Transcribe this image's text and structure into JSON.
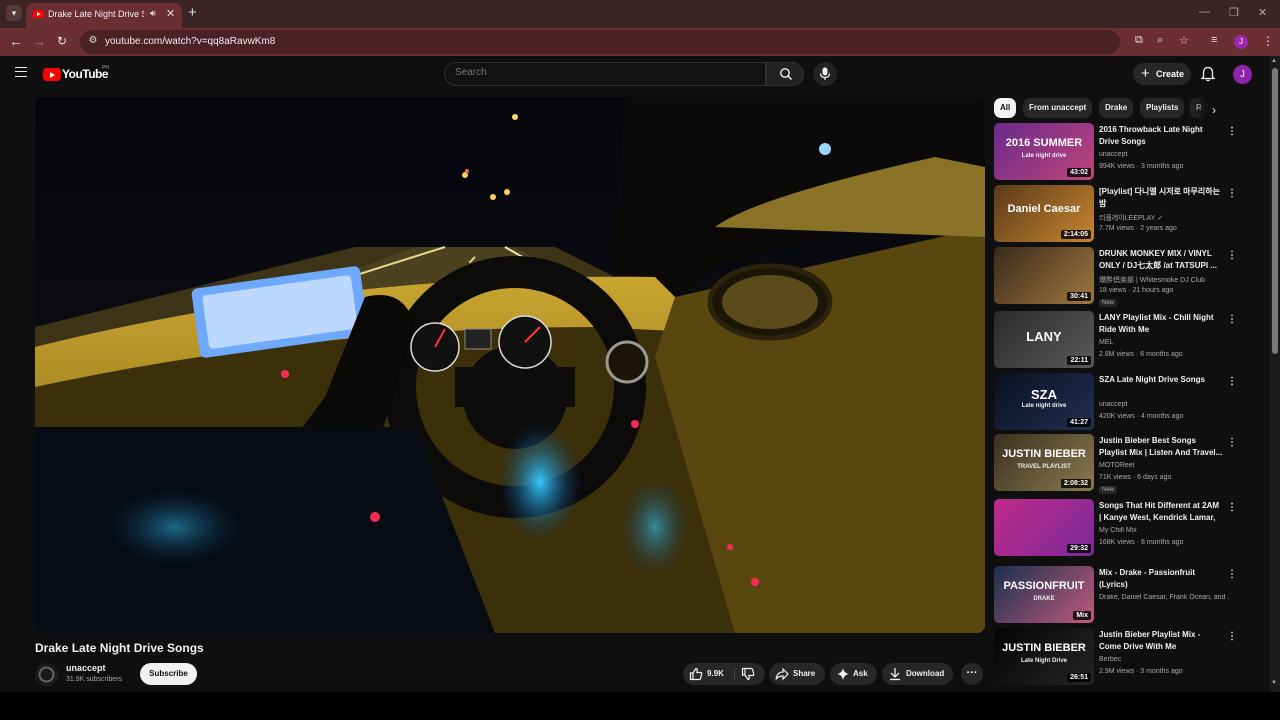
{
  "browser": {
    "tab_title": "Drake Late Night Drive Songs",
    "url": "youtube.com/watch?v=qq8aRavwKm8",
    "profile_initial": "J"
  },
  "header": {
    "logo_text": "YouTube",
    "country_code": "PH",
    "search_placeholder": "Search",
    "create_label": "Create",
    "avatar_initial": "J"
  },
  "video": {
    "title": "Drake Late Night Drive Songs",
    "channel": "unaccept",
    "subscribers": "31.9K subscribers",
    "subscribe_label": "Subscribe",
    "likes": "9.9K",
    "share_label": "Share",
    "ask_label": "Ask",
    "download_label": "Download"
  },
  "chips": [
    "All",
    "From unaccept",
    "Drake",
    "Playlists",
    "R"
  ],
  "recommendations": [
    {
      "title": "2016 Throwback Late Night Drive Songs",
      "channel": "unaccept",
      "meta": "994K views · 3 months ago",
      "duration": "43:02",
      "badge": "",
      "thumb_text": "2016 SUMMER",
      "thumb_sub": "Late night drive",
      "thumb_colors": [
        "#6a2a8c",
        "#c0457a"
      ]
    },
    {
      "title": "[Playlist] 다니엘 시저로 마무리하는 밤",
      "channel": "리플레이LEEPLAY ✓",
      "meta": "7.7M views · 2 years ago",
      "duration": "2:14:05",
      "badge": "",
      "thumb_text": "Daniel Caesar",
      "thumb_sub": "",
      "thumb_colors": [
        "#5a3a1a",
        "#c8862e"
      ]
    },
    {
      "title": "DRUNK MONKEY MIX / VINYL ONLY / DJ七太郎 /at TATSUPI ...",
      "channel": "爆酔倶楽部 | Whitesmoke DJ Club",
      "meta": "18 views · 21 hours ago",
      "duration": "30:41",
      "badge": "New",
      "thumb_text": "",
      "thumb_sub": "",
      "thumb_colors": [
        "#3a2a1a",
        "#a07840"
      ]
    },
    {
      "title": "LANY Playlist Mix - Chill Night Ride With Me",
      "channel": "MEL",
      "meta": "2.8M views · 6 months ago",
      "duration": "22:11",
      "badge": "",
      "thumb_text": "LANY",
      "thumb_sub": "",
      "thumb_colors": [
        "#2a2a2a",
        "#5a5a5a"
      ]
    },
    {
      "title": "SZA Late Night Drive Songs",
      "channel": "unaccept",
      "meta": "420K views · 4 months ago",
      "duration": "41:27",
      "badge": "",
      "thumb_text": "SZA",
      "thumb_sub": "Late night drive",
      "thumb_colors": [
        "#0a1020",
        "#203050"
      ]
    },
    {
      "title": "Justin Bieber Best Songs Playlist Mix | Listen And Travel...",
      "channel": "MOTOReel",
      "meta": "71K views · 6 days ago",
      "duration": "2:08:32",
      "badge": "New",
      "thumb_text": "JUSTIN BIEBER",
      "thumb_sub": "TRAVEL PLAYLIST",
      "thumb_colors": [
        "#3a3020",
        "#8a7a50"
      ]
    },
    {
      "title": "Songs That Hit Different at 2AM | Kanye West, Kendrick Lamar, ...",
      "channel": "My Chill Mix",
      "meta": "168K views · 8 months ago",
      "duration": "29:32",
      "badge": "",
      "thumb_text": "",
      "thumb_sub": "",
      "thumb_colors": [
        "#c02a8a",
        "#7a2a9a"
      ]
    },
    {
      "title": "Mix - Drake - Passionfruit (Lyrics)",
      "channel": "Drake, Daniel Caesar, Frank Ocean, and ...",
      "meta": "",
      "duration": "Mix",
      "badge": "",
      "thumb_text": "PASSIONFRUIT",
      "thumb_sub": "DRAKE",
      "thumb_colors": [
        "#1a3050",
        "#c05a7a"
      ]
    },
    {
      "title": "Justin Bieber Playlist Mix - Come Drive With Me",
      "channel": "Berbec",
      "meta": "2.9M views · 3 months ago",
      "duration": "26:51",
      "badge": "",
      "thumb_text": "JUSTIN BIEBER",
      "thumb_sub": "Late Night Drive",
      "thumb_colors": [
        "#050505",
        "#252525"
      ]
    }
  ]
}
